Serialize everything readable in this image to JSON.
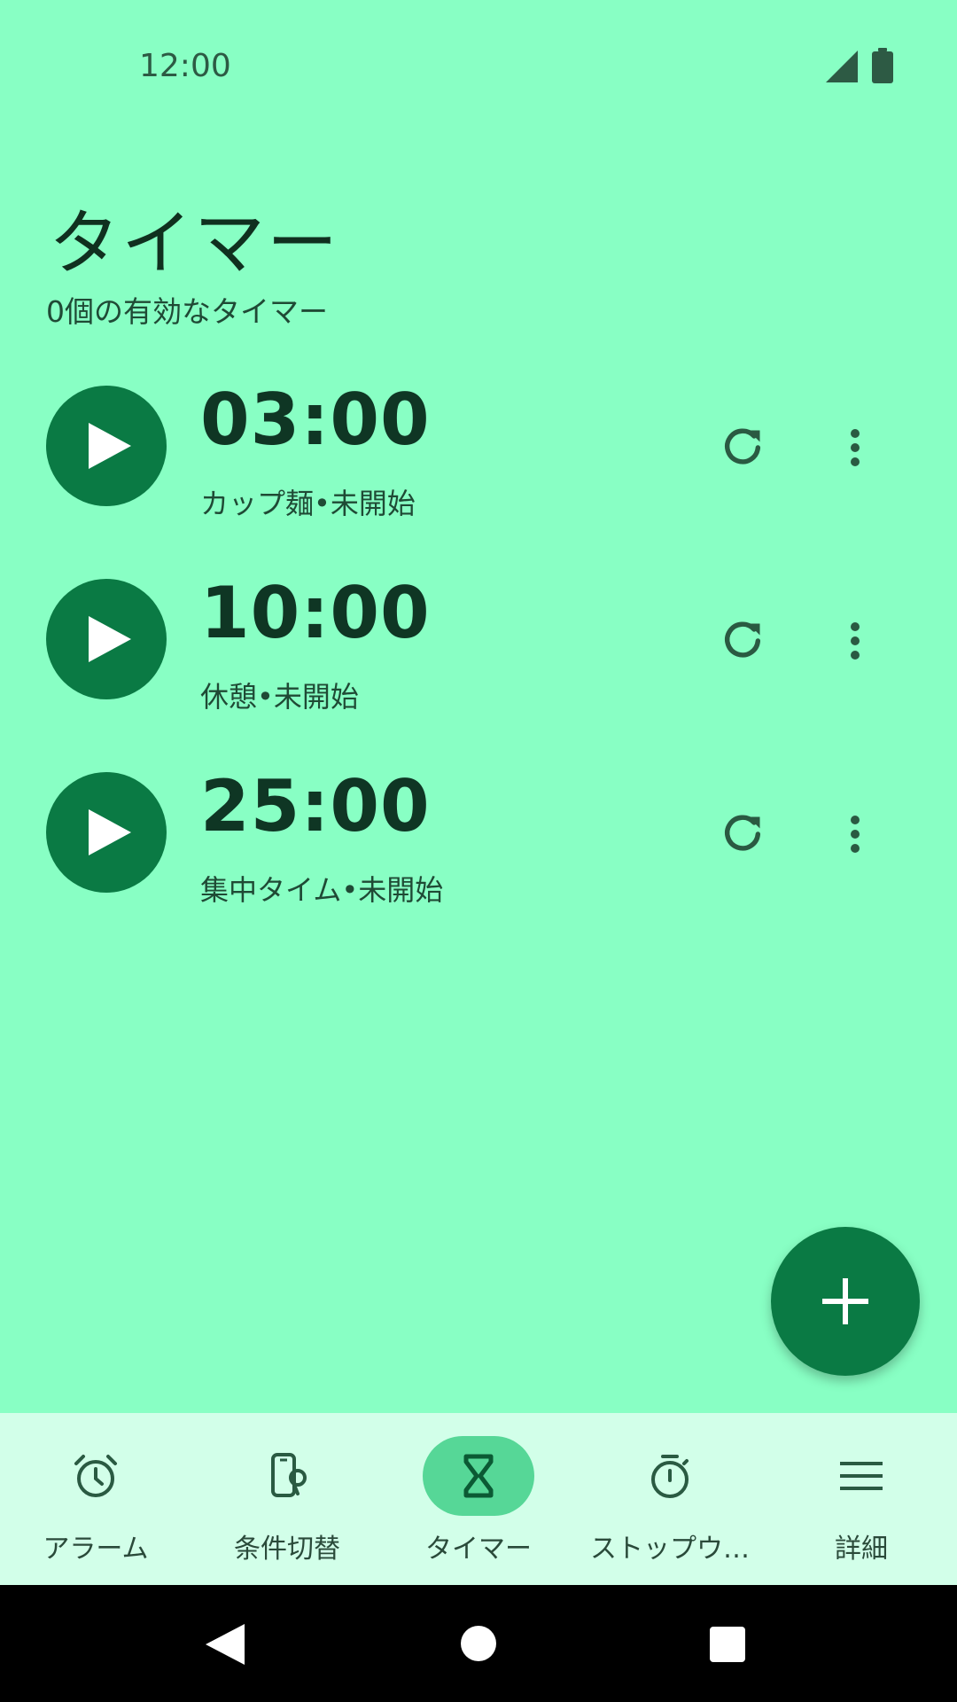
{
  "status_bar": {
    "time": "12:00",
    "icons": [
      "signal-icon",
      "battery-icon"
    ]
  },
  "header": {
    "title": "タイマー",
    "subtitle": "0個の有効なタイマー"
  },
  "timers": [
    {
      "time": "03:00",
      "label": "カップ麺•未開始"
    },
    {
      "time": "10:00",
      "label": "休憩•未開始"
    },
    {
      "time": "25:00",
      "label": "集中タイム•未開始"
    }
  ],
  "fab": {
    "icon": "plus-icon"
  },
  "bottom_nav": {
    "items": [
      {
        "label": "アラーム",
        "icon": "alarm-clock-icon",
        "active": false
      },
      {
        "label": "条件切替",
        "icon": "phone-toggle-icon",
        "active": false
      },
      {
        "label": "タイマー",
        "icon": "hourglass-icon",
        "active": true
      },
      {
        "label": "ストップウ…",
        "icon": "stopwatch-icon",
        "active": false
      },
      {
        "label": "詳細",
        "icon": "menu-icon",
        "active": false
      }
    ]
  },
  "colors": {
    "background": "#88ffc4",
    "accent": "#0a7a44",
    "nav_background": "#d2ffe9",
    "nav_active_pill": "#56d797"
  }
}
